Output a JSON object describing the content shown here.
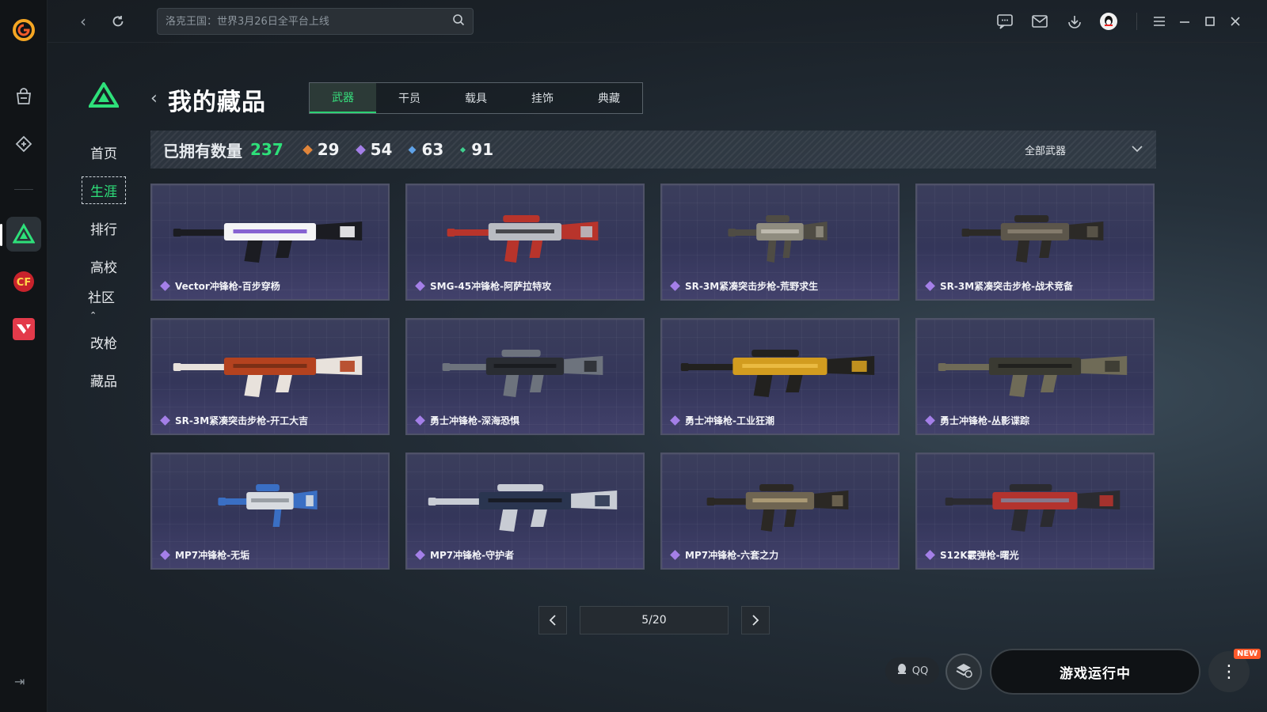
{
  "topbar": {
    "search_placeholder": "洛克王国：世界3月26日全平台上线"
  },
  "sidebar": {
    "items": [
      {
        "label": "首页"
      },
      {
        "label": "生涯"
      },
      {
        "label": "排行"
      },
      {
        "label": "高校"
      },
      {
        "label": "社区"
      },
      {
        "label": "改枪"
      },
      {
        "label": "藏品"
      }
    ],
    "active_index": 1,
    "community_suffix": "⌃"
  },
  "header": {
    "title": "我的藏品",
    "tabs": [
      {
        "label": "武器"
      },
      {
        "label": "干员"
      },
      {
        "label": "载具"
      },
      {
        "label": "挂饰"
      },
      {
        "label": "典藏"
      }
    ],
    "active_tab": 0
  },
  "stats": {
    "label": "已拥有数量",
    "total": "237",
    "counts": [
      {
        "value": "29",
        "color": "#e0853a"
      },
      {
        "value": "54",
        "color": "#a47fe8"
      },
      {
        "value": "63",
        "color": "#5fa2e8"
      },
      {
        "value": "91",
        "color": "#3fcf8e"
      }
    ],
    "filter_label": "全部武器"
  },
  "weapons": [
    {
      "name": "Vector冲锋枪-百步穿杨",
      "palette": [
        "#f4f4f6",
        "#1b1c22",
        "#6b3fc9"
      ],
      "rarity_color": "#a47fe8"
    },
    {
      "name": "SMG-45冲锋枪-阿萨拉特攻",
      "palette": [
        "#b9bcc2",
        "#b8342b",
        "#2a2b30"
      ],
      "rarity_color": "#a47fe8"
    },
    {
      "name": "SR-3M紧凑突击步枪-荒野求生",
      "palette": [
        "#8f8c7f",
        "#4f4c44",
        "#c9c6ba"
      ],
      "rarity_color": "#a47fe8"
    },
    {
      "name": "SR-3M紧凑突击步枪-战术竞备",
      "palette": [
        "#5c564b",
        "#2c2a27",
        "#8e8574"
      ],
      "rarity_color": "#a47fe8"
    },
    {
      "name": "SR-3M紧凑突击步枪-开工大吉",
      "palette": [
        "#b4421f",
        "#e8e2dc",
        "#6d2a14"
      ],
      "rarity_color": "#a47fe8"
    },
    {
      "name": "勇士冲锋枪-深海恐惧",
      "palette": [
        "#2a2d33",
        "#6d737d",
        "#16181c"
      ],
      "rarity_color": "#a47fe8"
    },
    {
      "name": "勇士冲锋枪-工业狂潮",
      "palette": [
        "#d29c1f",
        "#22211f",
        "#f0c24a"
      ],
      "rarity_color": "#a47fe8"
    },
    {
      "name": "勇士冲锋枪-丛影谍踪",
      "palette": [
        "#3a3a32",
        "#6f6b57",
        "#1c1c19"
      ],
      "rarity_color": "#a47fe8"
    },
    {
      "name": "MP7冲锋枪-无垢",
      "palette": [
        "#d8dbe0",
        "#3a6fc4",
        "#8b9096"
      ],
      "rarity_color": "#a47fe8"
    },
    {
      "name": "MP7冲锋枪-守护者",
      "palette": [
        "#2a3550",
        "#c8ccd4",
        "#14161b"
      ],
      "rarity_color": "#a47fe8"
    },
    {
      "name": "MP7冲锋枪-六套之力",
      "palette": [
        "#6f6552",
        "#2b2824",
        "#b9a67d"
      ],
      "rarity_color": "#a47fe8"
    },
    {
      "name": "S12K霰弹枪-曙光",
      "palette": [
        "#b3332e",
        "#2b2b30",
        "#7a8aa3"
      ],
      "rarity_color": "#a47fe8"
    }
  ],
  "pagination": {
    "label": "5/20"
  },
  "footer": {
    "qq_label": "QQ",
    "run_label": "游戏运行中",
    "new_badge": "NEW"
  }
}
